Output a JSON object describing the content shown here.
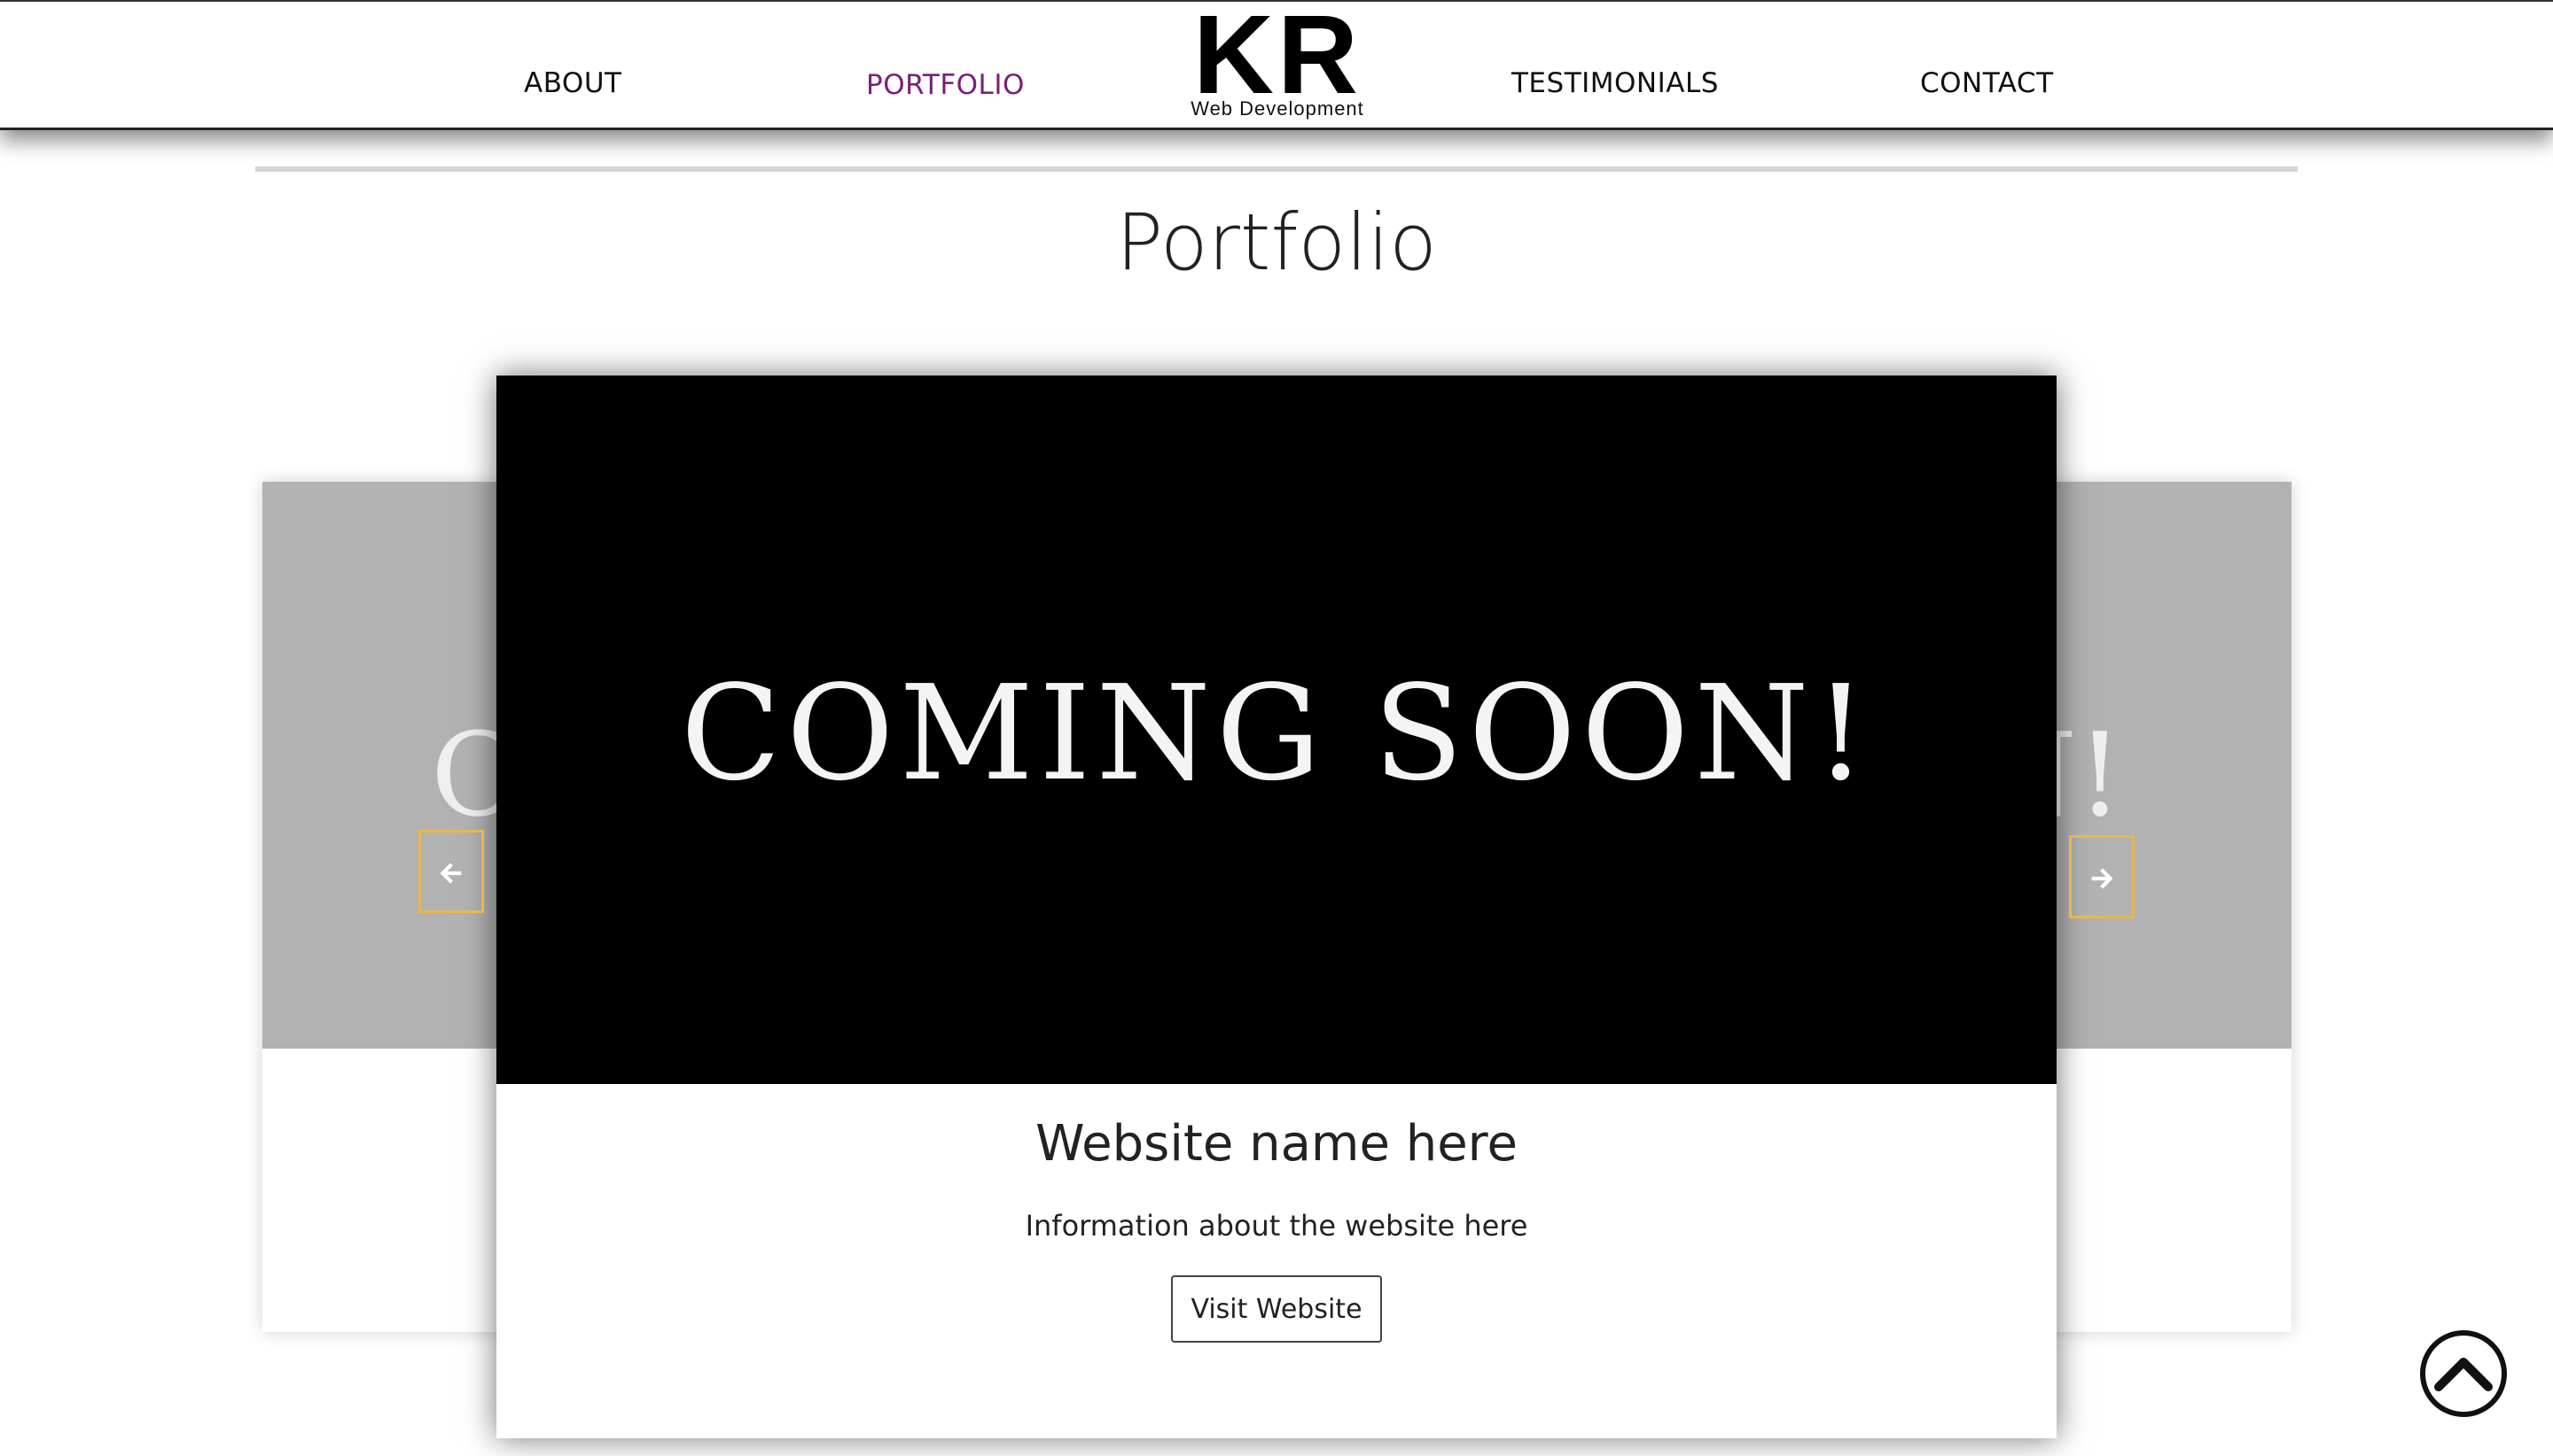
{
  "nav": {
    "about": "ABOUT",
    "portfolio": "PORTFOLIO",
    "testimonials": "TESTIMONIALS",
    "contact": "CONTACT",
    "active_color": "#7a1e7a"
  },
  "logo": {
    "mark": "KR",
    "subtitle": "Web Development"
  },
  "page": {
    "title": "Portfolio"
  },
  "carousel": {
    "side_left_partial_text": "C",
    "side_right_partial_text": "N!",
    "prev_icon": "arrow-left-icon",
    "next_icon": "arrow-right-icon",
    "accent_color": "#e8b84a",
    "active_slide": {
      "image_text": "COMING SOON!",
      "title": "Website name here",
      "info": "Information about the website here",
      "button_label": "Visit Website"
    }
  },
  "back_to_top": {
    "icon": "chevron-up-circle-icon"
  }
}
